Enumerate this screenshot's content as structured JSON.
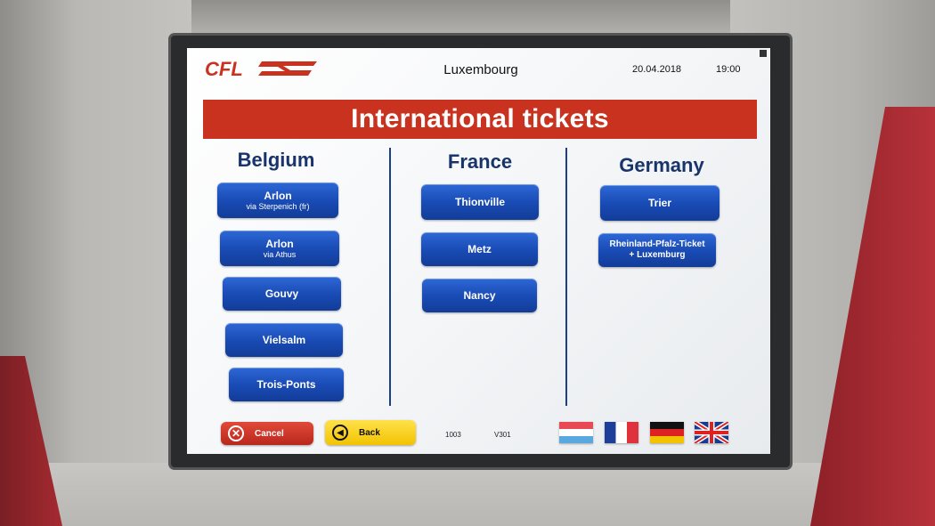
{
  "header": {
    "logo_text": "CFL",
    "city": "Luxembourg",
    "date": "20.04.2018",
    "time": "19:00"
  },
  "title": "International tickets",
  "columns": [
    {
      "country": "Belgium",
      "buttons": [
        {
          "label": "Arlon",
          "sub": "via Sterpenich (fr)"
        },
        {
          "label": "Arlon",
          "sub": "via Athus"
        },
        {
          "label": "Gouvy",
          "sub": ""
        },
        {
          "label": "Vielsalm",
          "sub": ""
        },
        {
          "label": "Trois-Ponts",
          "sub": ""
        }
      ]
    },
    {
      "country": "France",
      "buttons": [
        {
          "label": "Thionville",
          "sub": ""
        },
        {
          "label": "Metz",
          "sub": ""
        },
        {
          "label": "Nancy",
          "sub": ""
        }
      ]
    },
    {
      "country": "Germany",
      "buttons": [
        {
          "label": "Trier",
          "sub": ""
        },
        {
          "label": "Rheinland-Pfalz-Ticket",
          "sub": "+ Luxemburg"
        }
      ]
    }
  ],
  "footer": {
    "cancel_label": "Cancel",
    "back_label": "Back",
    "code_1": "1003",
    "code_2": "V301",
    "flags": [
      "luxembourg-flag",
      "france-flag",
      "germany-flag",
      "uk-flag"
    ]
  },
  "colors": {
    "title_bar": "#c8321f",
    "button_blue": "#1a4cb6",
    "heading_navy": "#18346b",
    "cancel_red": "#d23b2c",
    "back_yellow": "#f8d21c"
  }
}
